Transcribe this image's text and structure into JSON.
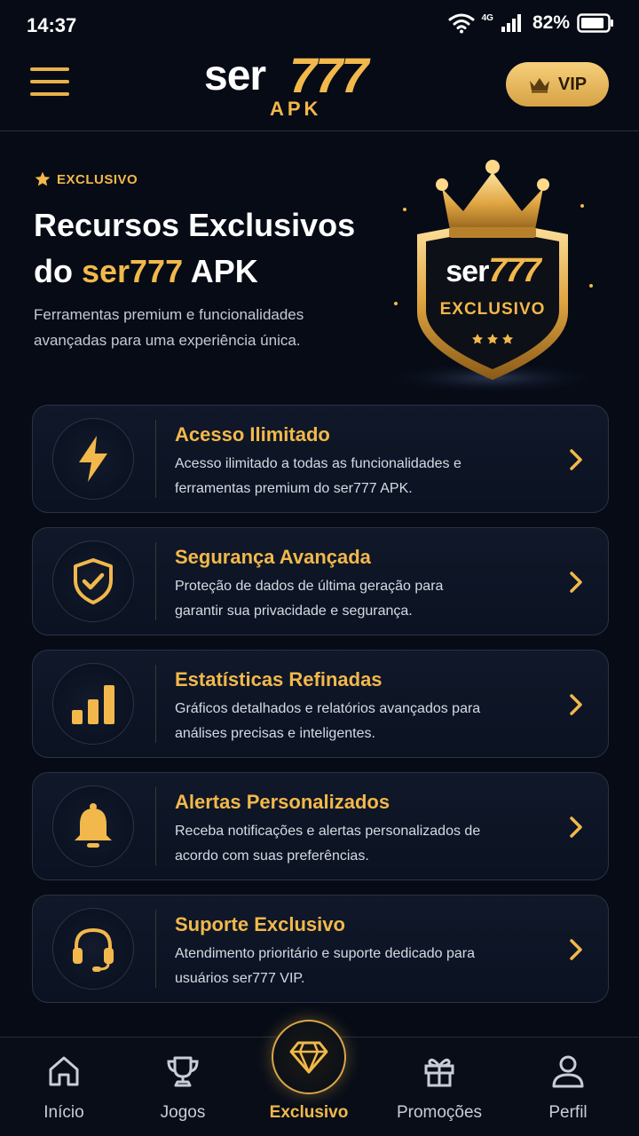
{
  "status_bar": {
    "time": "14:37",
    "network": "4G",
    "battery": "82%"
  },
  "header": {
    "logo_word1": "ser",
    "logo_word2": "777",
    "logo_sub": "APK",
    "vip_label": "VIP"
  },
  "hero": {
    "badge": "EXCLUSIVO",
    "title_line1": "Recursos Exclusivos",
    "title_pre": "do ",
    "title_brand": "ser777",
    "title_post": " APK",
    "subtitle": "Ferramentas premium e funcionalidades avançadas para uma experiência única.",
    "shield_word1": "ser",
    "shield_word2": "777",
    "shield_label": "EXCLUSIVO"
  },
  "features": [
    {
      "icon": "lightning-icon",
      "title": "Acesso Ilimitado",
      "description": "Acesso ilimitado a todas as funcionalidades e ferramentas premium do ser777 APK."
    },
    {
      "icon": "shield-check-icon",
      "title": "Segurança Avançada",
      "description": "Proteção de dados de última geração para garantir sua privacidade e segurança."
    },
    {
      "icon": "bar-chart-icon",
      "title": "Estatísticas Refinadas",
      "description": "Gráficos detalhados e relatórios avançados para análises precisas e inteligentes."
    },
    {
      "icon": "bell-icon",
      "title": "Alertas Personalizados",
      "description": "Receba notificações e alertas personalizados de acordo com suas preferências."
    },
    {
      "icon": "headset-icon",
      "title": "Suporte Exclusivo",
      "description": "Atendimento prioritário e suporte dedicado para usuários ser777 VIP."
    }
  ],
  "bottom_nav": [
    {
      "label": "Início",
      "icon": "home-icon"
    },
    {
      "label": "Jogos",
      "icon": "trophy-icon"
    },
    {
      "label": "Exclusivo",
      "icon": "diamond-icon",
      "active": true
    },
    {
      "label": "Promoções",
      "icon": "gift-icon"
    },
    {
      "label": "Perfil",
      "icon": "user-icon"
    }
  ],
  "colors": {
    "accent": "#f2b84b",
    "background": "#060b16",
    "card": "#101829"
  }
}
